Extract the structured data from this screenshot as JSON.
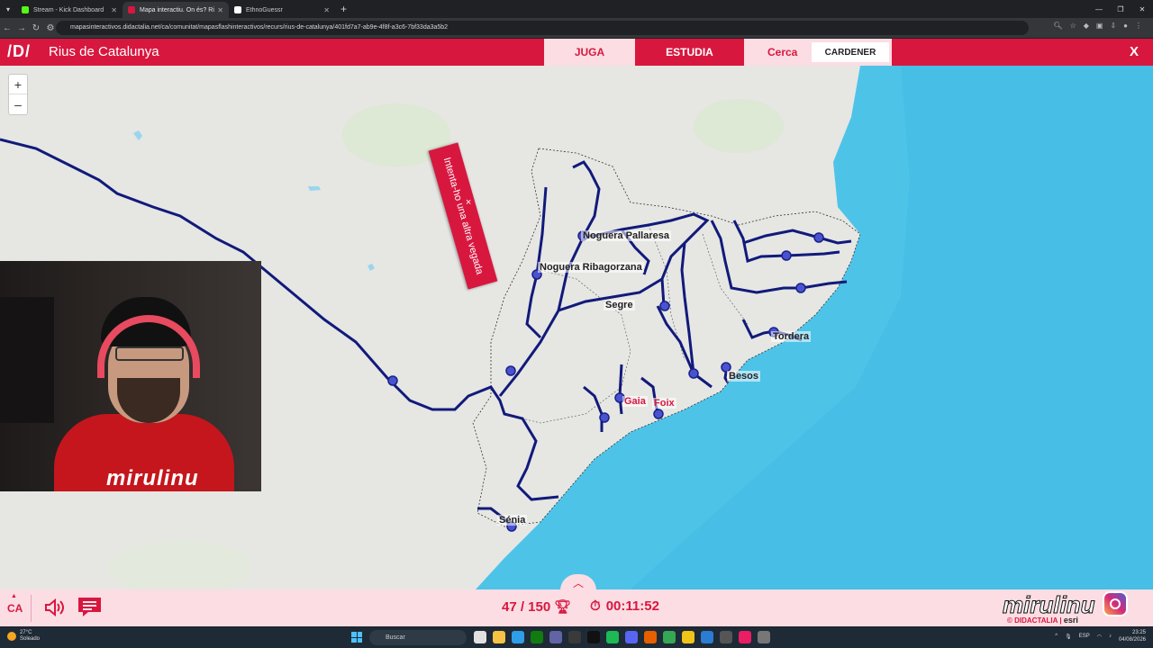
{
  "browser": {
    "tabs": [
      {
        "title": "Stream - Kick Dashboard",
        "color": "#53fc18"
      },
      {
        "title": "Mapa interactiu. On és? Ri",
        "color": "#d8173f"
      },
      {
        "title": "EthnoGuessr",
        "color": "#ffffff"
      }
    ],
    "url": "mapasinteractivos.didactalia.net/ca/comunitat/mapasflashinteractivos/recurs/rius-de-catalunya/401fd7a7-ab9e-4f8f-a3c6-7bf33da3a5b2"
  },
  "app": {
    "logo": "/D/",
    "title": "Rius de Catalunya",
    "modes": {
      "juga": "JUGA",
      "estudia": "ESTUDIA",
      "cerca": "Cerca"
    },
    "search_value": "CARDENER",
    "close": "X",
    "accent": "#d8173f"
  },
  "map": {
    "zoom_in": "+",
    "zoom_out": "–",
    "toast": "Intenta-ho una altra vegada",
    "toast_close": "×",
    "labels": {
      "noguera_pallaresa": "Noguera Pallaresa",
      "noguera_ribagorzana": "Noguera Ribagorzana",
      "segre": "Segre",
      "tordera": "Tordera",
      "besos": "Besos",
      "gaia": "Gaia",
      "foix": "Foix",
      "senia": "Sénia"
    }
  },
  "webcam": {
    "brand": "mirulinu"
  },
  "footer": {
    "lang": "CA",
    "score": "47 / 150",
    "timer": "00:11:52",
    "brand": "mirulinu",
    "credit_didactalia": "© DIDACTALIA",
    "credit_esri": "esri"
  },
  "taskbar": {
    "weather_temp": "27°C",
    "weather_desc": "Soleado",
    "search_placeholder": "Buscar",
    "lang": "ESP",
    "time": "23:25",
    "date": "04/08/2026"
  }
}
